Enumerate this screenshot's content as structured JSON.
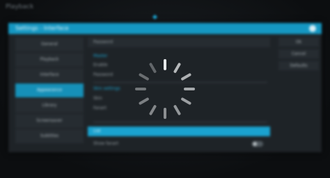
{
  "topbar": {
    "clock": "Playback"
  },
  "dialog": {
    "title": "Settings - Interface"
  },
  "categories": [
    {
      "label": "General",
      "active": false
    },
    {
      "label": "Playback",
      "active": false
    },
    {
      "label": "Interface",
      "active": false
    },
    {
      "label": "Appearance",
      "active": true
    },
    {
      "label": "Library",
      "active": false
    },
    {
      "label": "Screensaver",
      "active": false
    },
    {
      "label": "Subtitles",
      "active": false
    }
  ],
  "settings": {
    "row1": "Password",
    "group1_header": "Master",
    "row2": "Enable",
    "row3": "Password",
    "group2_header": "Skin settings",
    "row4": "Skin",
    "row5": "Fanart",
    "row6": "List",
    "row7": "Show fanart",
    "row7_toggle": "off"
  },
  "side_actions": [
    "Ok",
    "Cancel",
    "Defaults"
  ],
  "spinner": {
    "state": "loading",
    "color": "#e6e8ea"
  }
}
